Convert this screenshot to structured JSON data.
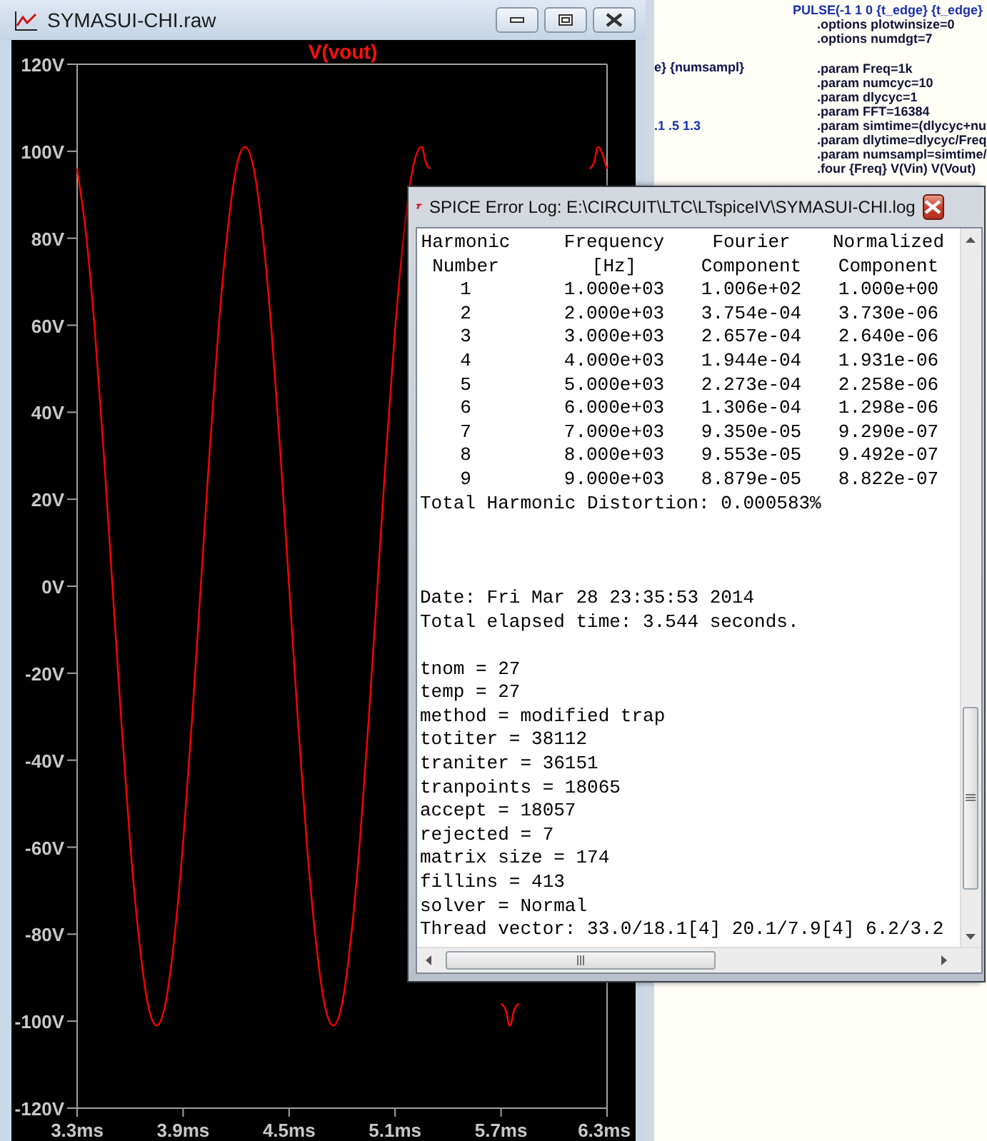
{
  "plot_window": {
    "title": "SYMASUI-CHI.raw",
    "chart_data": {
      "type": "line",
      "x": [
        3.3,
        3.35,
        3.4,
        3.45,
        3.5,
        3.55,
        3.6,
        3.65,
        3.7,
        3.75,
        3.8,
        3.85,
        3.9,
        3.95,
        4.0,
        4.05,
        4.1,
        4.15,
        4.2,
        4.25,
        4.3,
        4.35,
        4.4,
        4.45,
        4.5,
        4.55,
        4.6,
        4.65,
        4.7,
        4.75,
        4.8,
        4.85,
        4.9,
        4.95,
        5.0,
        5.05,
        5.1,
        5.15,
        5.2,
        5.25,
        5.3,
        5.5,
        5.7,
        5.75,
        5.8,
        6.0,
        6.2,
        6.25,
        6.3
      ],
      "series": [
        {
          "name": "V(vout)",
          "color": "#ff0000",
          "values": [
            96,
            81,
            59,
            31,
            0,
            -31,
            -59,
            -81,
            -96,
            -101,
            -96,
            -81,
            -59,
            -31,
            0,
            31,
            59,
            81,
            96,
            101,
            96,
            81,
            59,
            31,
            0,
            -31,
            -59,
            -81,
            -96,
            -101,
            -96,
            -81,
            -59,
            -31,
            0,
            31,
            59,
            81,
            96,
            101,
            96,
            null,
            -96,
            -101,
            -96,
            null,
            96,
            101,
            96
          ]
        }
      ],
      "xlim": [
        3.3,
        6.3
      ],
      "ylim": [
        -120,
        120
      ],
      "xticks": [
        {
          "value": 3.3,
          "label": "3.3ms"
        },
        {
          "value": 3.9,
          "label": "3.9ms"
        },
        {
          "value": 4.5,
          "label": "4.5ms"
        },
        {
          "value": 5.1,
          "label": "5.1ms"
        },
        {
          "value": 5.7,
          "label": "5.7ms"
        },
        {
          "value": 6.3,
          "label": "6.3ms"
        }
      ],
      "yticks": [
        {
          "value": 120,
          "label": "120V"
        },
        {
          "value": 100,
          "label": "100V"
        },
        {
          "value": 80,
          "label": "80V"
        },
        {
          "value": 60,
          "label": "60V"
        },
        {
          "value": 40,
          "label": "40V"
        },
        {
          "value": 20,
          "label": "20V"
        },
        {
          "value": 0,
          "label": "0V"
        },
        {
          "value": -20,
          "label": "-20V"
        },
        {
          "value": -40,
          "label": "-40V"
        },
        {
          "value": -60,
          "label": "-60V"
        },
        {
          "value": -80,
          "label": "-80V"
        },
        {
          "value": -100,
          "label": "-100V"
        },
        {
          "value": -120,
          "label": "-120V"
        }
      ]
    }
  },
  "netlist_window": {
    "left_lines": [
      {
        "text": "e} {numsampl}",
        "kind": "plain"
      },
      {
        "text": ".1 .5 1.3",
        "kind": "value"
      }
    ],
    "right_lines": [
      {
        "text": "PULSE(-1 1 0 {t_edge} {t_edge}",
        "kind": "value"
      },
      {
        "text": ".options plotwinsize=0",
        "kind": "directive"
      },
      {
        "text": ".options numdgt=7",
        "kind": "directive"
      },
      {
        "text": ".param Freq=1k",
        "kind": "directive"
      },
      {
        "text": ".param numcyc=10",
        "kind": "directive"
      },
      {
        "text": ".param dlycyc=1",
        "kind": "directive"
      },
      {
        "text": ".param FFT=16384",
        "kind": "directive"
      },
      {
        "text": ".param simtime=(dlycyc+nu",
        "kind": "directive"
      },
      {
        "text": ".param dlytime=dlycyc/Freq",
        "kind": "directive"
      },
      {
        "text": ".param numsampl=simtime/",
        "kind": "directive"
      },
      {
        "text": ".four {Freq} V(Vin) V(Vout)",
        "kind": "directive"
      }
    ]
  },
  "log_window": {
    "title": "SPICE Error Log: E:\\CIRCUIT\\LTC\\LTspiceIV\\SYMASUI-CHI.log",
    "columns": [
      {
        "title": "Harmonic",
        "subtitle": "Number"
      },
      {
        "title": "Frequency",
        "subtitle": "[Hz]"
      },
      {
        "title": "Fourier",
        "subtitle": "Component"
      },
      {
        "title": "Normalized",
        "subtitle": "Component"
      }
    ],
    "rows": [
      [
        "1",
        "1.000e+03",
        "1.006e+02",
        "1.000e+00"
      ],
      [
        "2",
        "2.000e+03",
        "3.754e-04",
        "3.730e-06"
      ],
      [
        "3",
        "3.000e+03",
        "2.657e-04",
        "2.640e-06"
      ],
      [
        "4",
        "4.000e+03",
        "1.944e-04",
        "1.931e-06"
      ],
      [
        "5",
        "5.000e+03",
        "2.273e-04",
        "2.258e-06"
      ],
      [
        "6",
        "6.000e+03",
        "1.306e-04",
        "1.298e-06"
      ],
      [
        "7",
        "7.000e+03",
        "9.350e-05",
        "9.290e-07"
      ],
      [
        "8",
        "8.000e+03",
        "9.553e-05",
        "9.492e-07"
      ],
      [
        "9",
        "9.000e+03",
        "8.879e-05",
        "8.822e-07"
      ]
    ],
    "summary": "Total Harmonic Distortion: 0.000583%",
    "timing": [
      "Date: Fri Mar 28 23:35:53 2014",
      "Total elapsed time: 3.544 seconds."
    ],
    "stats": [
      "tnom = 27",
      "temp = 27",
      "method = modified trap",
      "totiter = 38112",
      "traniter = 36151",
      "tranpoints = 18065",
      "accept = 18057",
      "rejected = 7",
      "matrix size = 174",
      "fillins = 413",
      "solver = Normal",
      "Thread vector: 33.0/18.1[4] 20.1/7.9[4] 6.2/3.2"
    ]
  }
}
